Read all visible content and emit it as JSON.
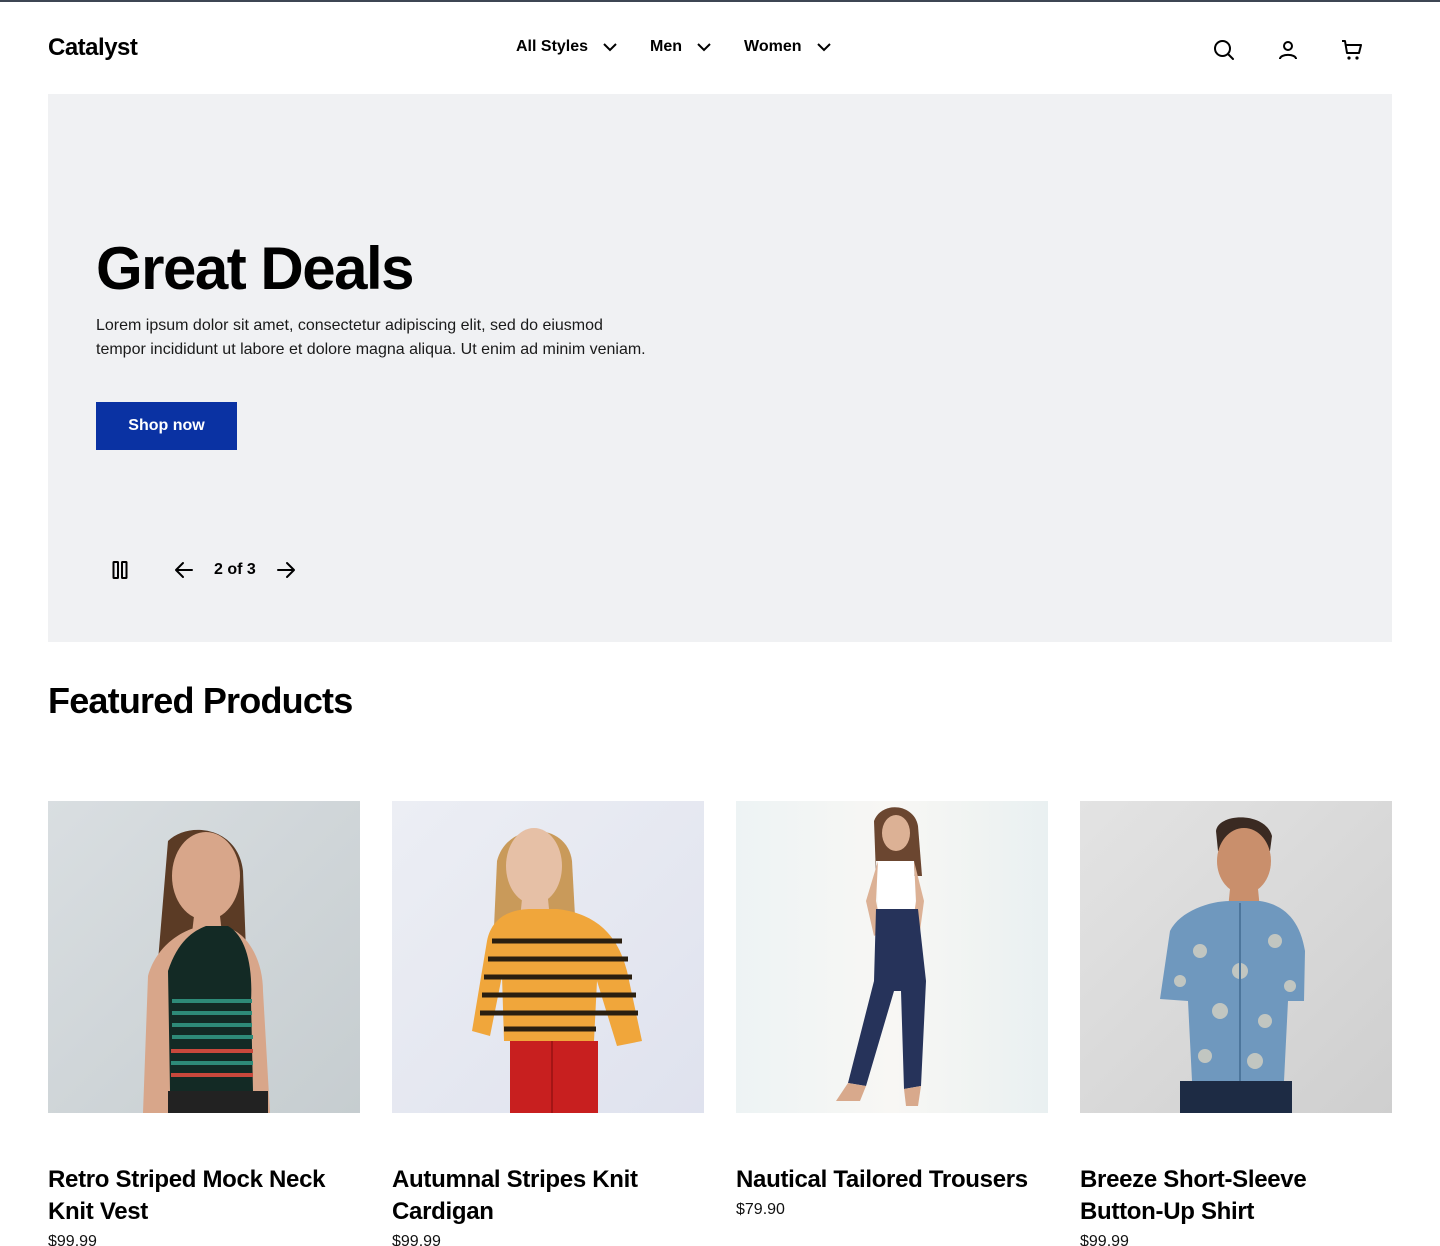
{
  "header": {
    "logo": "Catalyst",
    "nav": [
      {
        "label": "All Styles"
      },
      {
        "label": "Men"
      },
      {
        "label": "Women"
      }
    ]
  },
  "hero": {
    "title": "Great Deals",
    "body": "Lorem ipsum dolor sit amet, consectetur adipiscing elit, sed do eiusmod tempor incididunt ut labore et dolore magna aliqua. Ut enim ad minim veniam.",
    "cta_label": "Shop now",
    "slide_counter": "2 of 3"
  },
  "featured": {
    "title": "Featured Products",
    "products": [
      {
        "name": "Retro Striped Mock Neck Knit Vest",
        "price": "$99.99"
      },
      {
        "name": "Autumnal Stripes Knit Cardigan",
        "price": "$99.99"
      },
      {
        "name": "Nautical Tailored Trousers",
        "price": "$79.90"
      },
      {
        "name": "Breeze Short-Sleeve Button-Up Shirt",
        "price": "$99.99"
      }
    ]
  },
  "colors": {
    "accent": "#0a32a3",
    "hero_bg": "#f0f1f3"
  },
  "icons": [
    "search-icon",
    "user-icon",
    "cart-icon",
    "chevron-down-icon",
    "pause-icon",
    "arrow-left-icon",
    "arrow-right-icon"
  ]
}
